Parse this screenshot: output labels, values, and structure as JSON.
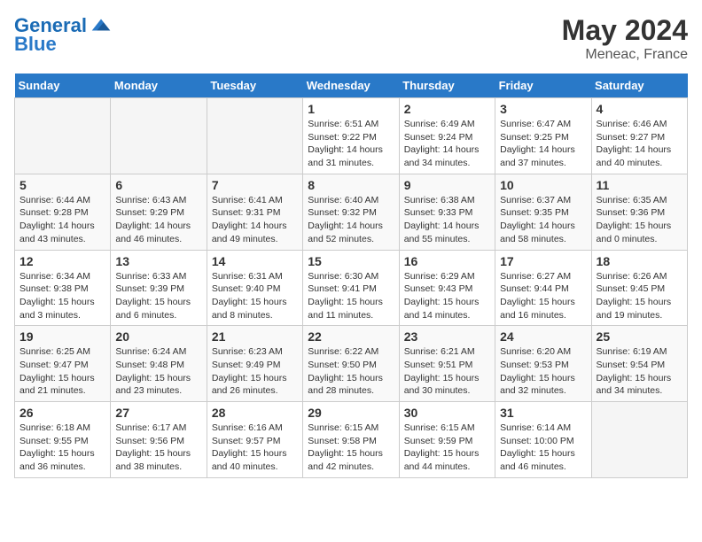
{
  "logo": {
    "line1": "General",
    "line2": "Blue"
  },
  "title": "May 2024",
  "location": "Meneac, France",
  "days_of_week": [
    "Sunday",
    "Monday",
    "Tuesday",
    "Wednesday",
    "Thursday",
    "Friday",
    "Saturday"
  ],
  "weeks": [
    [
      {
        "day": "",
        "info": ""
      },
      {
        "day": "",
        "info": ""
      },
      {
        "day": "",
        "info": ""
      },
      {
        "day": "1",
        "info": "Sunrise: 6:51 AM\nSunset: 9:22 PM\nDaylight: 14 hours and 31 minutes."
      },
      {
        "day": "2",
        "info": "Sunrise: 6:49 AM\nSunset: 9:24 PM\nDaylight: 14 hours and 34 minutes."
      },
      {
        "day": "3",
        "info": "Sunrise: 6:47 AM\nSunset: 9:25 PM\nDaylight: 14 hours and 37 minutes."
      },
      {
        "day": "4",
        "info": "Sunrise: 6:46 AM\nSunset: 9:27 PM\nDaylight: 14 hours and 40 minutes."
      }
    ],
    [
      {
        "day": "5",
        "info": "Sunrise: 6:44 AM\nSunset: 9:28 PM\nDaylight: 14 hours and 43 minutes."
      },
      {
        "day": "6",
        "info": "Sunrise: 6:43 AM\nSunset: 9:29 PM\nDaylight: 14 hours and 46 minutes."
      },
      {
        "day": "7",
        "info": "Sunrise: 6:41 AM\nSunset: 9:31 PM\nDaylight: 14 hours and 49 minutes."
      },
      {
        "day": "8",
        "info": "Sunrise: 6:40 AM\nSunset: 9:32 PM\nDaylight: 14 hours and 52 minutes."
      },
      {
        "day": "9",
        "info": "Sunrise: 6:38 AM\nSunset: 9:33 PM\nDaylight: 14 hours and 55 minutes."
      },
      {
        "day": "10",
        "info": "Sunrise: 6:37 AM\nSunset: 9:35 PM\nDaylight: 14 hours and 58 minutes."
      },
      {
        "day": "11",
        "info": "Sunrise: 6:35 AM\nSunset: 9:36 PM\nDaylight: 15 hours and 0 minutes."
      }
    ],
    [
      {
        "day": "12",
        "info": "Sunrise: 6:34 AM\nSunset: 9:38 PM\nDaylight: 15 hours and 3 minutes."
      },
      {
        "day": "13",
        "info": "Sunrise: 6:33 AM\nSunset: 9:39 PM\nDaylight: 15 hours and 6 minutes."
      },
      {
        "day": "14",
        "info": "Sunrise: 6:31 AM\nSunset: 9:40 PM\nDaylight: 15 hours and 8 minutes."
      },
      {
        "day": "15",
        "info": "Sunrise: 6:30 AM\nSunset: 9:41 PM\nDaylight: 15 hours and 11 minutes."
      },
      {
        "day": "16",
        "info": "Sunrise: 6:29 AM\nSunset: 9:43 PM\nDaylight: 15 hours and 14 minutes."
      },
      {
        "day": "17",
        "info": "Sunrise: 6:27 AM\nSunset: 9:44 PM\nDaylight: 15 hours and 16 minutes."
      },
      {
        "day": "18",
        "info": "Sunrise: 6:26 AM\nSunset: 9:45 PM\nDaylight: 15 hours and 19 minutes."
      }
    ],
    [
      {
        "day": "19",
        "info": "Sunrise: 6:25 AM\nSunset: 9:47 PM\nDaylight: 15 hours and 21 minutes."
      },
      {
        "day": "20",
        "info": "Sunrise: 6:24 AM\nSunset: 9:48 PM\nDaylight: 15 hours and 23 minutes."
      },
      {
        "day": "21",
        "info": "Sunrise: 6:23 AM\nSunset: 9:49 PM\nDaylight: 15 hours and 26 minutes."
      },
      {
        "day": "22",
        "info": "Sunrise: 6:22 AM\nSunset: 9:50 PM\nDaylight: 15 hours and 28 minutes."
      },
      {
        "day": "23",
        "info": "Sunrise: 6:21 AM\nSunset: 9:51 PM\nDaylight: 15 hours and 30 minutes."
      },
      {
        "day": "24",
        "info": "Sunrise: 6:20 AM\nSunset: 9:53 PM\nDaylight: 15 hours and 32 minutes."
      },
      {
        "day": "25",
        "info": "Sunrise: 6:19 AM\nSunset: 9:54 PM\nDaylight: 15 hours and 34 minutes."
      }
    ],
    [
      {
        "day": "26",
        "info": "Sunrise: 6:18 AM\nSunset: 9:55 PM\nDaylight: 15 hours and 36 minutes."
      },
      {
        "day": "27",
        "info": "Sunrise: 6:17 AM\nSunset: 9:56 PM\nDaylight: 15 hours and 38 minutes."
      },
      {
        "day": "28",
        "info": "Sunrise: 6:16 AM\nSunset: 9:57 PM\nDaylight: 15 hours and 40 minutes."
      },
      {
        "day": "29",
        "info": "Sunrise: 6:15 AM\nSunset: 9:58 PM\nDaylight: 15 hours and 42 minutes."
      },
      {
        "day": "30",
        "info": "Sunrise: 6:15 AM\nSunset: 9:59 PM\nDaylight: 15 hours and 44 minutes."
      },
      {
        "day": "31",
        "info": "Sunrise: 6:14 AM\nSunset: 10:00 PM\nDaylight: 15 hours and 46 minutes."
      },
      {
        "day": "",
        "info": ""
      }
    ]
  ]
}
